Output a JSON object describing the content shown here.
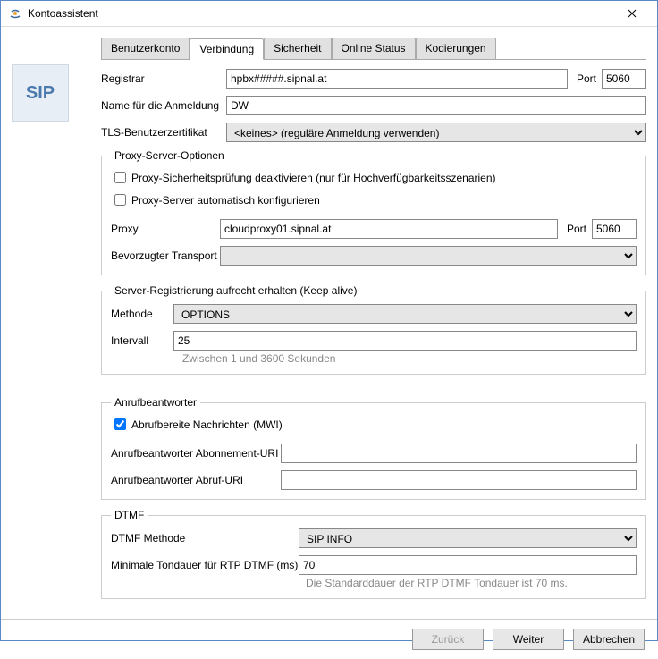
{
  "window": {
    "title": "Kontoassistent"
  },
  "sip_badge": "SIP",
  "tabs": {
    "t0": "Benutzerkonto",
    "t1": "Verbindung",
    "t2": "Sicherheit",
    "t3": "Online Status",
    "t4": "Kodierungen"
  },
  "labels": {
    "registrar": "Registrar",
    "port": "Port",
    "login_name": "Name für die Anmeldung",
    "tls_cert": "TLS-Benutzerzertifikat",
    "proxy_group": "Proxy-Server-Optionen",
    "proxy_sec_disable": "Proxy-Sicherheitsprüfung deaktivieren (nur für Hochverfügbarkeitsszenarien)",
    "proxy_auto": "Proxy-Server automatisch konfigurieren",
    "proxy": "Proxy",
    "pref_transport": "Bevorzugter Transport",
    "keepalive_group": "Server-Registrierung aufrecht erhalten (Keep alive)",
    "method": "Methode",
    "interval": "Intervall",
    "interval_hint": "Zwischen 1 und 3600 Sekunden",
    "vm_group": "Anrufbeantworter",
    "mwi": "Abrufbereite Nachrichten (MWI)",
    "vm_sub_uri": "Anrufbeantworter Abonnement-URI",
    "vm_fetch_uri": "Anrufbeantworter Abruf-URI",
    "dtmf_group": "DTMF",
    "dtmf_method": "DTMF Methode",
    "dtmf_min": "Minimale Tondauer für RTP DTMF (ms)",
    "dtmf_hint": "Die Standarddauer der RTP DTMF Tondauer ist 70 ms."
  },
  "values": {
    "registrar": "hpbx#####.sipnal.at",
    "registrar_port": "5060",
    "login_name": "DW",
    "tls_cert": "<keines> (reguläre Anmeldung verwenden)",
    "proxy_sec_disable": false,
    "proxy_auto": false,
    "proxy": "cloudproxy01.sipnal.at",
    "proxy_port": "5060",
    "pref_transport": "",
    "method": "OPTIONS",
    "interval": "25",
    "mwi": true,
    "vm_sub_uri": "",
    "vm_fetch_uri": "",
    "dtmf_method": "SIP INFO",
    "dtmf_min": "70"
  },
  "buttons": {
    "back": "Zurück",
    "next": "Weiter",
    "cancel": "Abbrechen"
  }
}
